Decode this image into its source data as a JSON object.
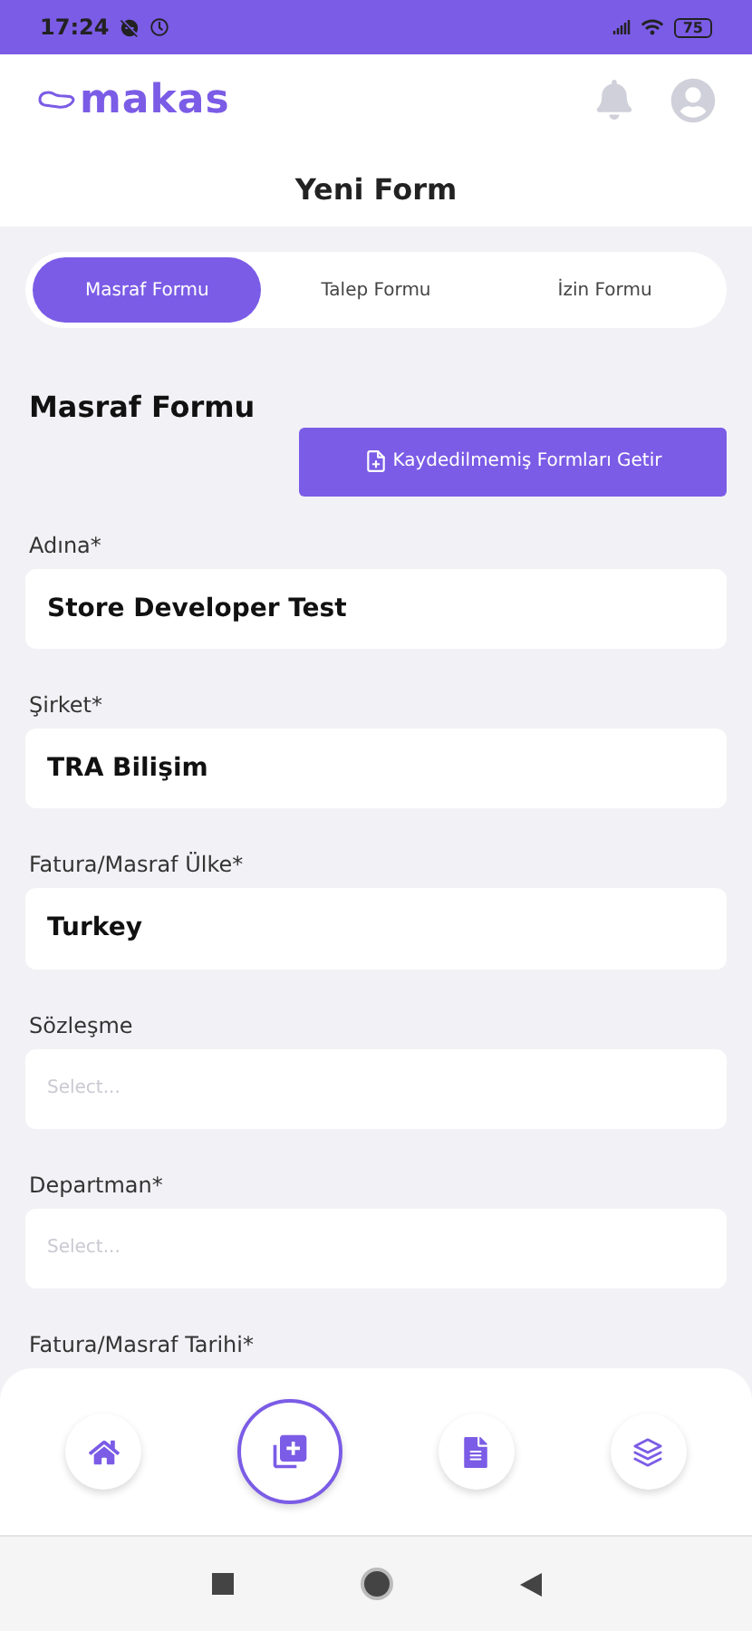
{
  "status_bar": {
    "time": "17:24",
    "battery": "75"
  },
  "header": {
    "logo": "makas",
    "title": "Yeni Form"
  },
  "tabs": [
    {
      "label": "Masraf Formu",
      "selected": true
    },
    {
      "label": "Talep Formu",
      "selected": false
    },
    {
      "label": "İzin Formu",
      "selected": false
    }
  ],
  "form": {
    "title": "Masraf Formu",
    "load_button": "Kaydedilmemiş Formları Getir",
    "fields": [
      {
        "label": "Adına*",
        "kind": "text",
        "value": "Store Developer Test"
      },
      {
        "label": "Şirket*",
        "kind": "text",
        "value": "TRA Bilişim"
      },
      {
        "label": "Fatura/Masraf Ülke*",
        "kind": "text",
        "value": "Turkey"
      },
      {
        "label": "Sözleşme",
        "kind": "select",
        "placeholder": "Select..."
      },
      {
        "label": "Departman*",
        "kind": "select",
        "placeholder": "Select..."
      }
    ],
    "next_label": "Fatura/Masraf Tarihi*"
  },
  "bottom_nav": [
    {
      "kind": "home",
      "selected": false
    },
    {
      "kind": "add",
      "selected": true
    },
    {
      "kind": "document",
      "selected": false
    },
    {
      "kind": "layers",
      "selected": false
    }
  ]
}
